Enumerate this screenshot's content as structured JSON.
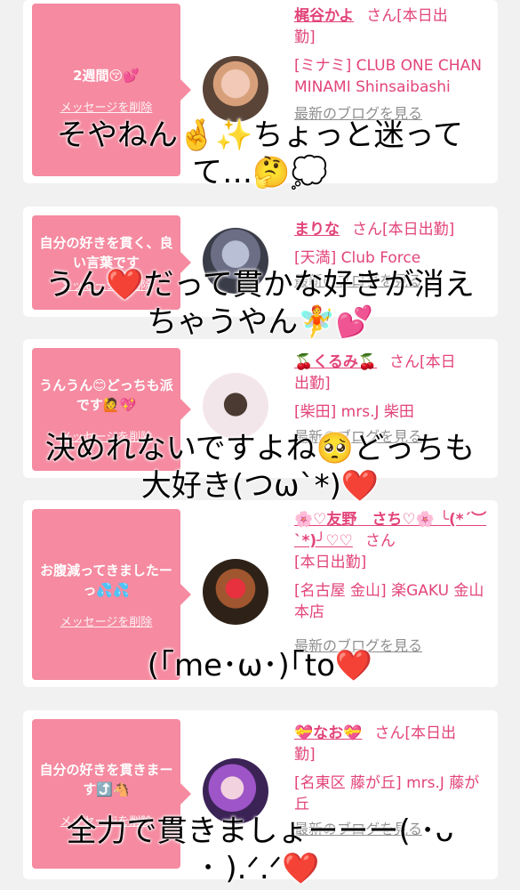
{
  "cards": [
    {
      "message": "2週間😚💕",
      "delete_label": "メッセージを削除",
      "name": "梶谷かよ",
      "honorific": "さん[本日出",
      "status_tail": "勤]",
      "shop": "[ミナミ] CLUB ONE CHAN MINAMI Shinsaibashi",
      "blog_label": "最新のブログを見る"
    },
    {
      "message": "自分の好きを貫く、良い言葉です",
      "delete_label": "メッセージを削除",
      "name": "まりな",
      "honorific": "さん[本日出勤]",
      "shop": "[天満] Club Force",
      "blog_label": "最新のブログを見る"
    },
    {
      "message": "うんうん😊どっちも派です🙋💖",
      "delete_label": "メッセージを削除",
      "name": "🍒くるみ🍒",
      "honorific": "さん[本日",
      "status_tail": "出勤]",
      "shop": "[柴田] mrs.J 柴田",
      "blog_label": "最新のブログを見る"
    },
    {
      "message": "お腹減ってきましたーっ💦💦",
      "delete_label": "メッセージを削除",
      "name": "🌸♡友野　さち♡🌸 ╰(*´︶`*)╯♡♡",
      "honorific": "さん",
      "status_tail": "[本日出勤]",
      "shop": "[名古屋 金山] 楽GAKU 金山本店",
      "blog_label": "最新のブログを見る"
    },
    {
      "message": "自分の好きを貫きまーす⤴️🐴",
      "delete_label": "メッセージを削除",
      "name": "💝なお💝",
      "honorific": "さん[本日出",
      "status_tail": "勤]",
      "shop": "[名東区 藤が丘] mrs.J 藤が丘",
      "blog_label": "最新のブログを見る"
    }
  ],
  "captions": [
    "そやねん🤞✨ちょっと迷って",
    "て…🤔💭",
    "うん❤️だって貫かな好きが消え",
    "ちゃうやん🧚💕",
    "決めれないですよね🥺どっちも",
    "大好き(つω`*)❤️",
    "(｢me･ω･)｢to❤️",
    "全力で貫きましょーーー( ･ᴗ",
    "･ ).ᐟ.ᐟ❤️"
  ]
}
